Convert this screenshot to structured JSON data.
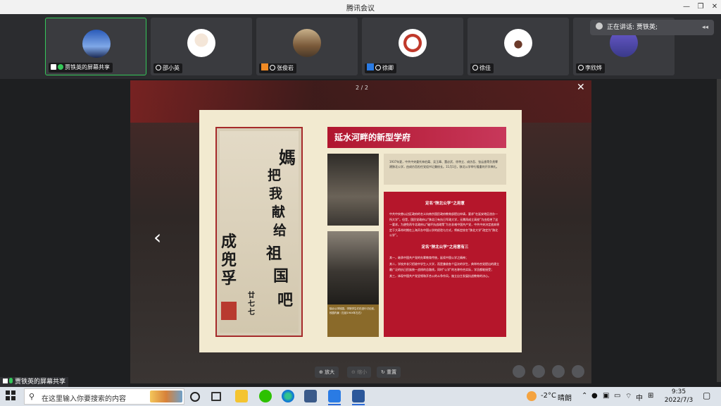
{
  "app": {
    "title": "腾讯会议"
  },
  "window_controls": {
    "minimize": "—",
    "restore": "❐",
    "close": "✕"
  },
  "participants": [
    {
      "name": "贾铁英的屏幕共享",
      "active": true
    },
    {
      "name": "邵小英",
      "active": false
    },
    {
      "name": "张俊岩",
      "active": false
    },
    {
      "name": "徐卿",
      "active": false
    },
    {
      "name": "徐佳",
      "active": false
    },
    {
      "name": "李欣烨",
      "active": false
    }
  ],
  "speaking": {
    "label": "正在讲话: 贾铁英;"
  },
  "viewer": {
    "counter": "2 / 2",
    "close": "✕",
    "prev": "‹",
    "zoom_in": "放大",
    "zoom_out": "缩小",
    "reset": "重置"
  },
  "slide": {
    "header": "延水河畔的新型学府",
    "letter_chars": [
      "媽",
      "把",
      "我",
      "献",
      "给",
      "祖",
      "国",
      "吧"
    ],
    "letter_signature": "成兜孚",
    "letter_date": "廿七七",
    "intro": "1937年夏，中共中央委托林伯渠、吴玉章、董必武、徐特立、成仿吾、张云逸等负责筹建陕北公学，由成仿吾担任党组书记兼校长。11月1日，陕北公学举行隆重的开学典礼。",
    "section1_title": "定名“陕北公学”之用意",
    "section1_text": "中共中央曾以边区政府的名义向南京国民政府教育部提出申请，要求“在延安地区创办一所大学”。但是，国民党政府以“陕北已有抗日军政大学，无需再成立高校”为由拒绝了这一要求。为避免再令北政府以“破坏抗战政策”为名非难中国共产党，中共中央决定放弃原定于大革命时期在上海开办中国公学的经验与方式，将新定校名“陕北大学”改定为“陕北公学”。",
    "section2_title": "定名“陕北公学”之用意有三",
    "section2_text1": "其一，继承中国共产党的先辈教育传统，延续中国公学之精神；",
    "section2_text2": "其二，学校并非只招收中学生入大学，而是兼收各个层次的学生，典举符合党提出的建立最广泛的抗日民族统一战线的总路线，同时“公学”的名称符合实际，学员都能接受；",
    "section2_text3": "其三，体现中国共产党坚韧和开合公的斗争作风，施立自主发展抗战教育的决心。",
    "photo_caption": "陕北公学校园，学院学生们在进行讨论前，校园内景（左起19XX年左右）"
  },
  "screen_share_label": "贾铁英的屏幕共享",
  "taskbar": {
    "search_placeholder": "在这里输入你要搜索的内容",
    "weather_temp": "-2°C",
    "weather_text": "晴朗",
    "ime": "中",
    "time": "9:35",
    "date": "2022/7/3"
  },
  "colors": {
    "accent_green": "#34c759",
    "slide_red": "#b5162b",
    "slide_bg": "#f2ead0",
    "taskbar": "#dde3ea"
  }
}
